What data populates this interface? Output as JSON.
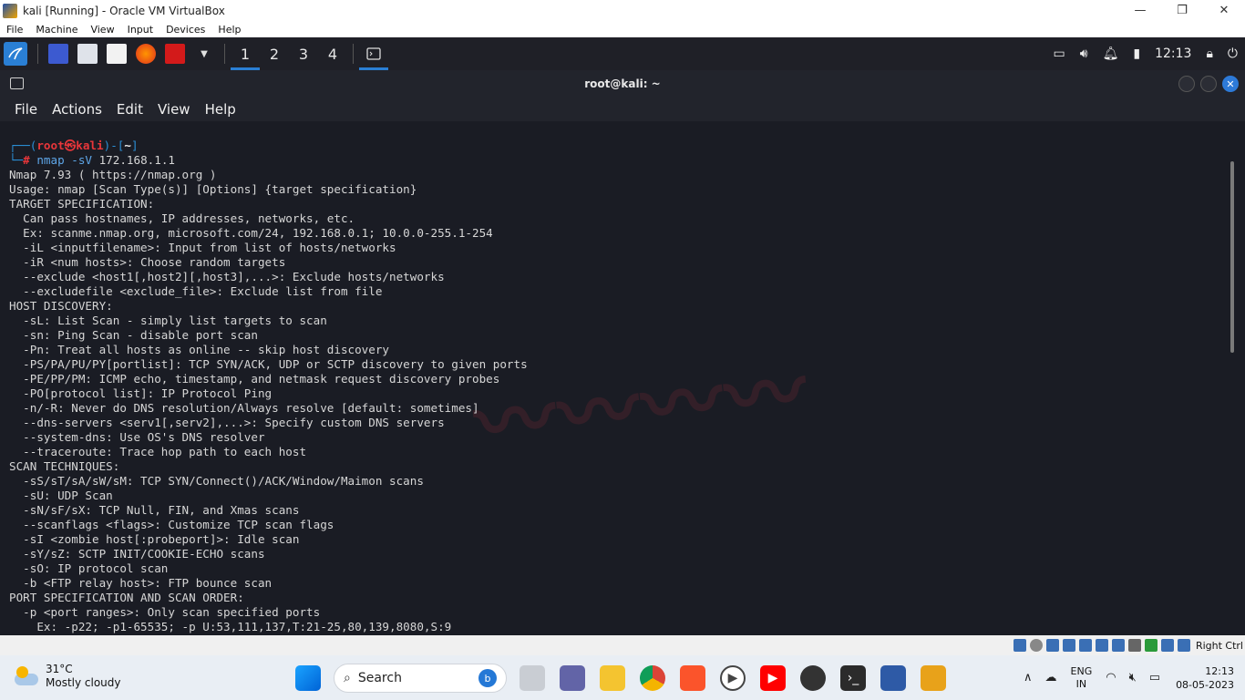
{
  "host_window": {
    "title": "kali [Running] - Oracle VM VirtualBox",
    "controls": {
      "minimize": "—",
      "restore": "❐",
      "close": "✕"
    },
    "menu": [
      "File",
      "Machine",
      "View",
      "Input",
      "Devices",
      "Help"
    ]
  },
  "kali_panel": {
    "workspaces": [
      "1",
      "2",
      "3",
      "4"
    ],
    "active_workspace": "1",
    "time": "12:13"
  },
  "terminal": {
    "title": "root@kali: ~",
    "menu": [
      "File",
      "Actions",
      "Edit",
      "View",
      "Help"
    ],
    "prompt": {
      "frame_top": "┌──(",
      "user": "root㉿kali",
      "mid": ")-[",
      "dir": "~",
      "end": "]",
      "frame_bottom": "└─",
      "symbol": "# ",
      "command": "nmap -sV",
      "args": " 172.168.1.1"
    },
    "output": [
      "Nmap 7.93 ( https://nmap.org )",
      "Usage: nmap [Scan Type(s)] [Options] {target specification}",
      "TARGET SPECIFICATION:",
      "  Can pass hostnames, IP addresses, networks, etc.",
      "  Ex: scanme.nmap.org, microsoft.com/24, 192.168.0.1; 10.0.0-255.1-254",
      "  -iL <inputfilename>: Input from list of hosts/networks",
      "  -iR <num hosts>: Choose random targets",
      "  --exclude <host1[,host2][,host3],...>: Exclude hosts/networks",
      "  --excludefile <exclude_file>: Exclude list from file",
      "HOST DISCOVERY:",
      "  -sL: List Scan - simply list targets to scan",
      "  -sn: Ping Scan - disable port scan",
      "  -Pn: Treat all hosts as online -- skip host discovery",
      "  -PS/PA/PU/PY[portlist]: TCP SYN/ACK, UDP or SCTP discovery to given ports",
      "  -PE/PP/PM: ICMP echo, timestamp, and netmask request discovery probes",
      "  -PO[protocol list]: IP Protocol Ping",
      "  -n/-R: Never do DNS resolution/Always resolve [default: sometimes]",
      "  --dns-servers <serv1[,serv2],...>: Specify custom DNS servers",
      "  --system-dns: Use OS's DNS resolver",
      "  --traceroute: Trace hop path to each host",
      "SCAN TECHNIQUES:",
      "  -sS/sT/sA/sW/sM: TCP SYN/Connect()/ACK/Window/Maimon scans",
      "  -sU: UDP Scan",
      "  -sN/sF/sX: TCP Null, FIN, and Xmas scans",
      "  --scanflags <flags>: Customize TCP scan flags",
      "  -sI <zombie host[:probeport]>: Idle scan",
      "  -sY/sZ: SCTP INIT/COOKIE-ECHO scans",
      "  -sO: IP protocol scan",
      "  -b <FTP relay host>: FTP bounce scan",
      "PORT SPECIFICATION AND SCAN ORDER:",
      "  -p <port ranges>: Only scan specified ports",
      "    Ex: -p22; -p1-65535; -p U:53,111,137,T:21-25,80,139,8080,S:9"
    ]
  },
  "vbox_status": {
    "host_key": "Right Ctrl"
  },
  "taskbar": {
    "weather": {
      "temp": "31°C",
      "condition": "Mostly cloudy"
    },
    "search_label": "Search",
    "language": {
      "line1": "ENG",
      "line2": "IN"
    },
    "clock": {
      "time": "12:13",
      "date": "08-05-2023"
    }
  }
}
